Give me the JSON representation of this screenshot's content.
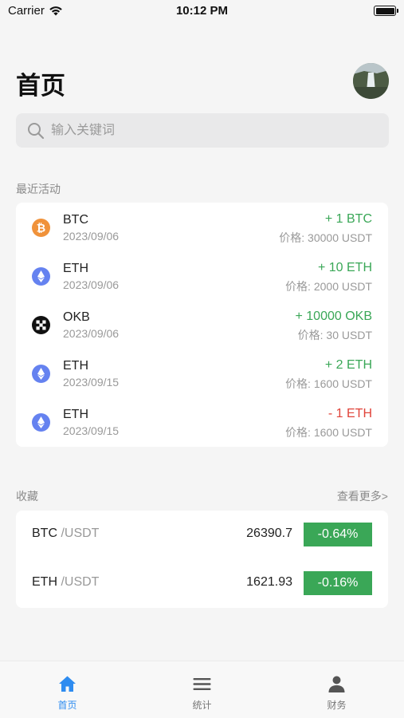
{
  "status_bar": {
    "carrier": "Carrier",
    "time": "10:12 PM",
    "battery_level": 1.0
  },
  "header": {
    "title": "首页"
  },
  "search": {
    "placeholder": "输入关键词"
  },
  "recent_activity": {
    "label": "最近活动",
    "items": [
      {
        "coin": "BTC",
        "icon": "bitcoin-icon",
        "date": "2023/09/06",
        "amount": "+ 1 BTC",
        "direction": "in",
        "price": "价格: 30000 USDT"
      },
      {
        "coin": "ETH",
        "icon": "ethereum-icon",
        "date": "2023/09/06",
        "amount": "+ 10 ETH",
        "direction": "in",
        "price": "价格: 2000 USDT"
      },
      {
        "coin": "OKB",
        "icon": "okb-icon",
        "date": "2023/09/06",
        "amount": "+ 10000 OKB",
        "direction": "in",
        "price": "价格: 30 USDT"
      },
      {
        "coin": "ETH",
        "icon": "ethereum-icon",
        "date": "2023/09/15",
        "amount": "+ 2 ETH",
        "direction": "in",
        "price": "价格: 1600 USDT"
      },
      {
        "coin": "ETH",
        "icon": "ethereum-icon",
        "date": "2023/09/15",
        "amount": "- 1 ETH",
        "direction": "out",
        "price": "价格: 1600 USDT"
      }
    ]
  },
  "favorites": {
    "label": "收藏",
    "see_more": "查看更多>",
    "items": [
      {
        "base": "BTC",
        "quote": "/USDT",
        "price": "26390.7",
        "change": "-0.64%"
      },
      {
        "base": "ETH",
        "quote": "/USDT",
        "price": "1621.93",
        "change": "-0.16%"
      }
    ]
  },
  "tab_bar": {
    "tabs": [
      {
        "label": "首页",
        "icon": "home-icon",
        "active": true
      },
      {
        "label": "统计",
        "icon": "menu-icon",
        "active": false
      },
      {
        "label": "财务",
        "icon": "person-icon",
        "active": false
      }
    ]
  },
  "colors": {
    "positive": "#3aa757",
    "negative": "#e0443a",
    "accent": "#2e8cf0",
    "badge": "#3aa757"
  }
}
